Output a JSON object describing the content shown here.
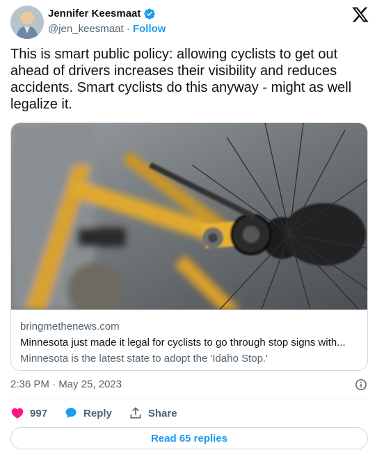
{
  "author": {
    "name": "Jennifer Keesmaat",
    "handle": "@jen_keesmaat",
    "separator": "·",
    "follow_label": "Follow",
    "verified": true
  },
  "tweet": {
    "text": "This is smart public policy: allowing cyclists to get out ahead of drivers increases their visibility and reduces accidents. Smart cyclists do this anyway - might as well legalize it."
  },
  "card": {
    "domain": "bringmethenews.com",
    "title": "Minnesota just made it legal for cyclists to go through stop signs with...",
    "description": "Minnesota is the latest state to adopt the 'Idaho Stop.'"
  },
  "timestamp": "2:36 PM · May 25, 2023",
  "actions": {
    "like_count": "997",
    "reply_label": "Reply",
    "share_label": "Share"
  },
  "read_replies_label": "Read 65 replies",
  "colors": {
    "accent": "#1d9bf0",
    "like": "#f91880",
    "text": "#0f1419",
    "muted": "#536471",
    "border": "#cfd9de",
    "bike_frame": "#e2a62a"
  },
  "icons": [
    "verified-badge-icon",
    "x-logo-icon",
    "info-icon",
    "heart-icon",
    "reply-bubble-icon",
    "share-icon"
  ]
}
